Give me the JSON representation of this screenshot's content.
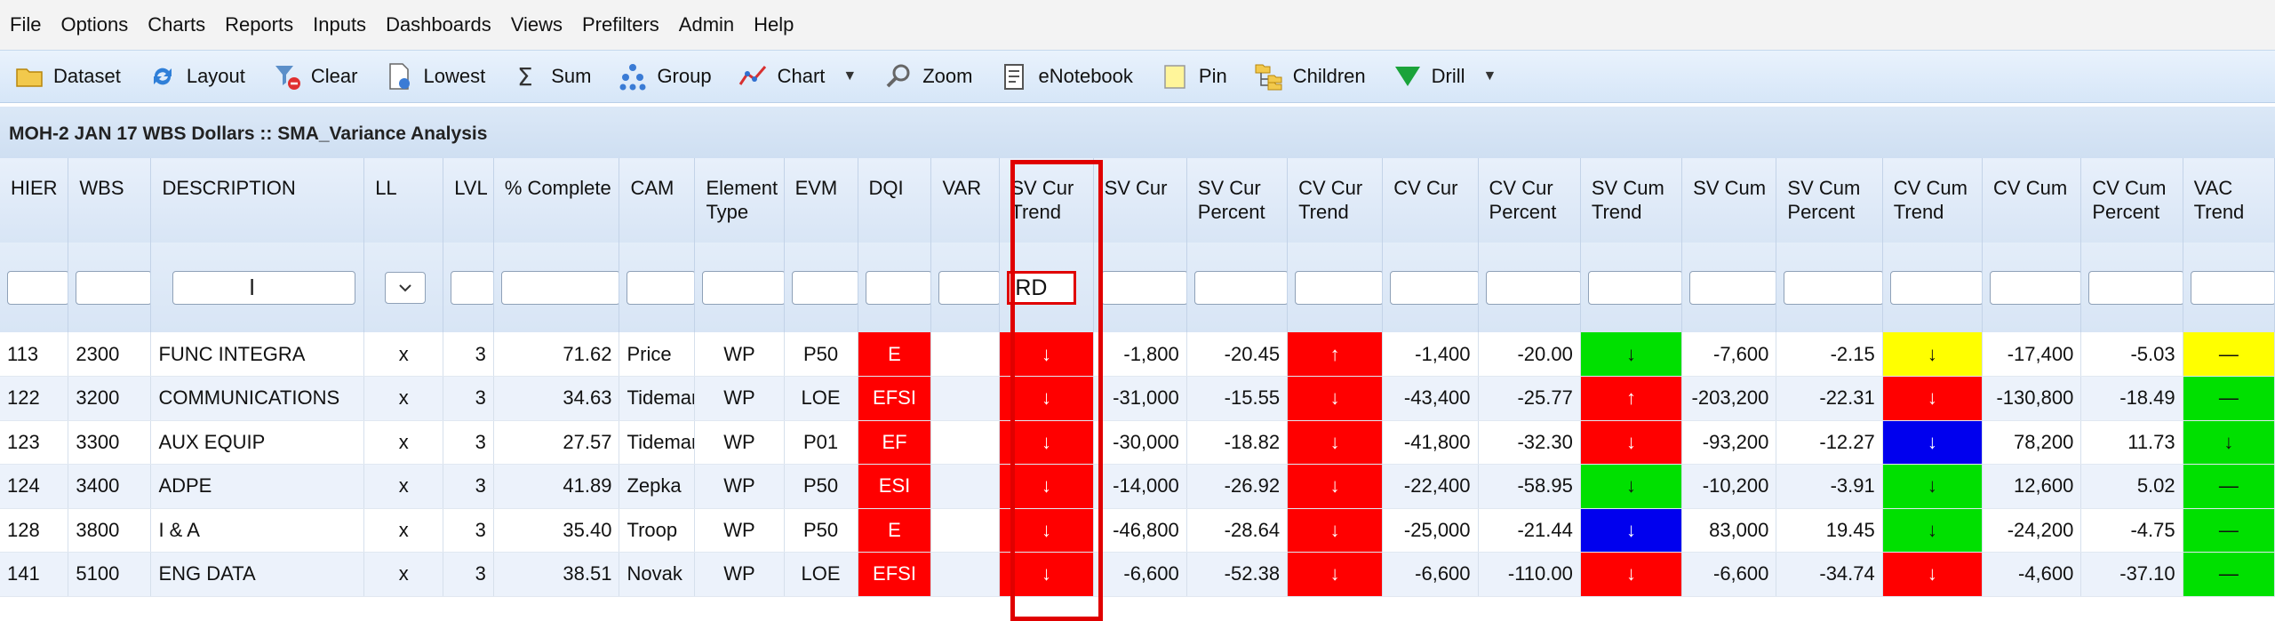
{
  "menu": [
    "File",
    "Options",
    "Charts",
    "Reports",
    "Inputs",
    "Dashboards",
    "Views",
    "Prefilters",
    "Admin",
    "Help"
  ],
  "toolbar": [
    {
      "label": "Dataset",
      "icon": "folder-icon"
    },
    {
      "label": "Layout",
      "icon": "refresh-icon"
    },
    {
      "label": "Clear",
      "icon": "clear-filter-icon"
    },
    {
      "label": "Lowest",
      "icon": "document-icon"
    },
    {
      "label": "Sum",
      "icon": "sigma-icon"
    },
    {
      "label": "Group",
      "icon": "group-icon"
    },
    {
      "label": "Chart",
      "icon": "line-chart-icon",
      "dropdown": true
    },
    {
      "label": "Zoom",
      "icon": "magnifier-icon"
    },
    {
      "label": "eNotebook",
      "icon": "notebook-icon"
    },
    {
      "label": "Pin",
      "icon": "note-icon"
    },
    {
      "label": "Children",
      "icon": "hierarchy-icon"
    },
    {
      "label": "Drill",
      "icon": "funnel-icon",
      "dropdown": true
    }
  ],
  "title": "MOH-2 JAN 17 WBS Dollars :: SMA_Variance Analysis",
  "columns": [
    "HIER",
    "WBS",
    "DESCRIPTION",
    "LL",
    "LVL",
    "% Complete",
    "CAM",
    "Element Type",
    "EVM",
    "DQI",
    "VAR",
    "SV Cur Trend",
    "SV Cur",
    "SV Cur Percent",
    "CV Cur Trend",
    "CV Cur",
    "CV Cur Percent",
    "SV Cum Trend",
    "SV Cum",
    "SV Cum Percent",
    "CV Cum Trend",
    "CV Cum",
    "CV Cum Percent",
    "VAC Trend"
  ],
  "filters": {
    "sv_cur_trend": "RD"
  },
  "colors": {
    "red": "#ff0000",
    "green": "#00e000",
    "yellow": "#ffff00",
    "blue": "#0000ee",
    "highlight": "#e00000"
  },
  "rows": [
    {
      "hier": "113",
      "wbs": "2300",
      "desc": "FUNC INTEGRA",
      "ll": "x",
      "lvl": "3",
      "pct": "71.62",
      "cam": "Price",
      "etype": "WP",
      "evm": "P50",
      "dqi": "E",
      "var": "",
      "sv_cur_trend": "↓",
      "sv_cur": "-1,800",
      "sv_cur_pct": "-20.45",
      "cv_cur_trend": "↑",
      "cv_cur": "-1,400",
      "cv_cur_pct": "-20.00",
      "sv_cum_trend": "↓",
      "sv_cum": "-7,600",
      "sv_cum_pct": "-2.15",
      "cv_cum_trend": "↓",
      "cv_cum": "-17,400",
      "cv_cum_pct": "-5.03",
      "vac_trend": "—",
      "c_sv_cur": "red",
      "c_cv_cur": "red",
      "c_sv_cum": "green",
      "c_cv_cum": "yellow",
      "c_vac": "yellow"
    },
    {
      "hier": "122",
      "wbs": "3200",
      "desc": "COMMUNICATIONS",
      "ll": "x",
      "lvl": "3",
      "pct": "34.63",
      "cam": "Tideman",
      "etype": "WP",
      "evm": "LOE",
      "dqi": "EFSI",
      "var": "",
      "sv_cur_trend": "↓",
      "sv_cur": "-31,000",
      "sv_cur_pct": "-15.55",
      "cv_cur_trend": "↓",
      "cv_cur": "-43,400",
      "cv_cur_pct": "-25.77",
      "sv_cum_trend": "↑",
      "sv_cum": "-203,200",
      "sv_cum_pct": "-22.31",
      "cv_cum_trend": "↓",
      "cv_cum": "-130,800",
      "cv_cum_pct": "-18.49",
      "vac_trend": "—",
      "c_sv_cur": "red",
      "c_cv_cur": "red",
      "c_sv_cum": "red",
      "c_cv_cum": "red",
      "c_vac": "green"
    },
    {
      "hier": "123",
      "wbs": "3300",
      "desc": "AUX EQUIP",
      "ll": "x",
      "lvl": "3",
      "pct": "27.57",
      "cam": "Tideman",
      "etype": "WP",
      "evm": "P01",
      "dqi": "EF",
      "var": "",
      "sv_cur_trend": "↓",
      "sv_cur": "-30,000",
      "sv_cur_pct": "-18.82",
      "cv_cur_trend": "↓",
      "cv_cur": "-41,800",
      "cv_cur_pct": "-32.30",
      "sv_cum_trend": "↓",
      "sv_cum": "-93,200",
      "sv_cum_pct": "-12.27",
      "cv_cum_trend": "↓",
      "cv_cum": "78,200",
      "cv_cum_pct": "11.73",
      "vac_trend": "↓",
      "c_sv_cur": "red",
      "c_cv_cur": "red",
      "c_sv_cum": "red",
      "c_cv_cum": "blue",
      "c_vac": "green"
    },
    {
      "hier": "124",
      "wbs": "3400",
      "desc": "ADPE",
      "ll": "x",
      "lvl": "3",
      "pct": "41.89",
      "cam": "Zepka",
      "etype": "WP",
      "evm": "P50",
      "dqi": "ESI",
      "var": "",
      "sv_cur_trend": "↓",
      "sv_cur": "-14,000",
      "sv_cur_pct": "-26.92",
      "cv_cur_trend": "↓",
      "cv_cur": "-22,400",
      "cv_cur_pct": "-58.95",
      "sv_cum_trend": "↓",
      "sv_cum": "-10,200",
      "sv_cum_pct": "-3.91",
      "cv_cum_trend": "↓",
      "cv_cum": "12,600",
      "cv_cum_pct": "5.02",
      "vac_trend": "—",
      "c_sv_cur": "red",
      "c_cv_cur": "red",
      "c_sv_cum": "green",
      "c_cv_cum": "green",
      "c_vac": "green"
    },
    {
      "hier": "128",
      "wbs": "3800",
      "desc": "I & A",
      "ll": "x",
      "lvl": "3",
      "pct": "35.40",
      "cam": "Troop",
      "etype": "WP",
      "evm": "P50",
      "dqi": "E",
      "var": "",
      "sv_cur_trend": "↓",
      "sv_cur": "-46,800",
      "sv_cur_pct": "-28.64",
      "cv_cur_trend": "↓",
      "cv_cur": "-25,000",
      "cv_cur_pct": "-21.44",
      "sv_cum_trend": "↓",
      "sv_cum": "83,000",
      "sv_cum_pct": "19.45",
      "cv_cum_trend": "↓",
      "cv_cum": "-24,200",
      "cv_cum_pct": "-4.75",
      "vac_trend": "—",
      "c_sv_cur": "red",
      "c_cv_cur": "red",
      "c_sv_cum": "blue",
      "c_cv_cum": "green",
      "c_vac": "green"
    },
    {
      "hier": "141",
      "wbs": "5100",
      "desc": "ENG DATA",
      "ll": "x",
      "lvl": "3",
      "pct": "38.51",
      "cam": "Novak",
      "etype": "WP",
      "evm": "LOE",
      "dqi": "EFSI",
      "var": "",
      "sv_cur_trend": "↓",
      "sv_cur": "-6,600",
      "sv_cur_pct": "-52.38",
      "cv_cur_trend": "↓",
      "cv_cur": "-6,600",
      "cv_cur_pct": "-110.00",
      "sv_cum_trend": "↓",
      "sv_cum": "-6,600",
      "sv_cum_pct": "-34.74",
      "cv_cum_trend": "↓",
      "cv_cum": "-4,600",
      "cv_cum_pct": "-37.10",
      "vac_trend": "—",
      "c_sv_cur": "red",
      "c_cv_cur": "red",
      "c_sv_cum": "red",
      "c_cv_cum": "red",
      "c_vac": "green"
    }
  ]
}
